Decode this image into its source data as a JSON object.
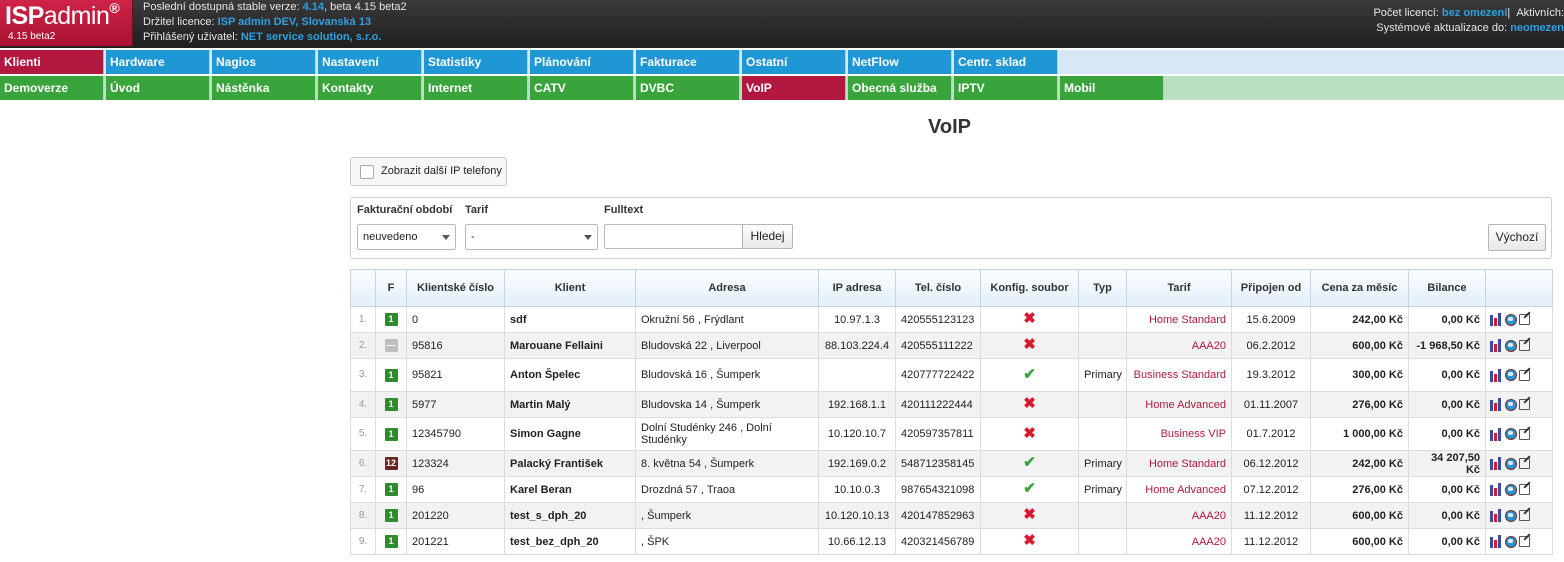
{
  "header": {
    "logo_main": "ISP",
    "logo_thin": "admin",
    "logo_reg": "®",
    "logo_version": "4.15 beta2",
    "line1_prefix": "Poslední dostupná stable verze:",
    "line1_stable": "4.14",
    "line1_suffix": ", beta 4.15 beta2",
    "line2_prefix": "Držitel licence:",
    "line2_value": "ISP admin DEV, Slovanská 13",
    "line3_prefix": "Přihlášený uživatel:",
    "line3_value": "NET service solution, s.r.o.",
    "right1_prefix": "Počet licencí:",
    "right1_value": "bez omezení",
    "right1_sep": "|",
    "right1_suffix": "Aktivních:",
    "right2_prefix": "Systémové aktualizace do:",
    "right2_value": "neomezen"
  },
  "menu_row1": [
    "Klienti",
    "Hardware",
    "Nagios",
    "Nastavení",
    "Statistiky",
    "Plánování",
    "Fakturace",
    "Ostatní",
    "NetFlow",
    "Centr. sklad"
  ],
  "menu_row2": [
    "Demoverze",
    "Úvod",
    "Nástěnka",
    "Kontakty",
    "Internet",
    "CATV",
    "DVBC",
    "VoIP",
    "Obecná služba",
    "IPTV",
    "Mobil"
  ],
  "colors": {
    "active_menu": "#b2183f",
    "menu_blue": "#1e97d4",
    "menu_green": "#3aa43c"
  },
  "page_title": "VoIP",
  "toggle_label": "Zobrazit další IP telefony",
  "filter": {
    "period_label": "Fakturační období",
    "period_value": "neuvedeno",
    "tariff_label": "Tarif",
    "tariff_value": "-",
    "fulltext_label": "Fulltext",
    "fulltext_value": "",
    "search_button": "Hledej",
    "default_button": "Výchozí"
  },
  "table": {
    "headers": [
      "",
      "F",
      "Klientské číslo",
      "Klient",
      "Adresa",
      "IP adresa",
      "Tel. číslo",
      "Konfig. soubor",
      "Typ",
      "Tarif",
      "Připojen od",
      "Cena za měsíc",
      "Bilance",
      ""
    ],
    "rows": [
      {
        "n": "1.",
        "f": "1",
        "f_style": "green",
        "cislo": "0",
        "klient": "sdf",
        "adresa": "Okružní 56 , Frýdlant",
        "ip": "10.97.1.3",
        "tel": "420555123123",
        "konfig": "no",
        "typ": "",
        "tarif": "Home Standard",
        "od": "15.6.2009",
        "cena": "242,00 Kč",
        "bilance": "0,00 Kč",
        "tall": false
      },
      {
        "n": "2.",
        "f": "—",
        "f_style": "gray",
        "cislo": "95816",
        "klient": "Marouane Fellaini",
        "adresa": "Bludovská 22 , Liverpool",
        "ip": "88.103.224.4",
        "tel": "420555111222",
        "konfig": "no",
        "typ": "",
        "tarif": "AAA20",
        "od": "06.2.2012",
        "cena": "600,00 Kč",
        "bilance": "-1 968,50 Kč",
        "tall": false
      },
      {
        "n": "3.",
        "f": "1",
        "f_style": "green",
        "cislo": "95821",
        "klient": "Anton Špelec",
        "adresa": "Bludovská 16 , Šumperk",
        "ip": "",
        "tel": "420777722422",
        "konfig": "yes",
        "typ": "Primary",
        "tarif": "Business Standard",
        "od": "19.3.2012",
        "cena": "300,00 Kč",
        "bilance": "0,00 Kč",
        "tall": true
      },
      {
        "n": "4.",
        "f": "1",
        "f_style": "green",
        "cislo": "5977",
        "klient": "Martin Malý",
        "adresa": "Bludovska 14 , Šumperk",
        "ip": "192.168.1.1",
        "tel": "420111222444",
        "konfig": "no",
        "typ": "",
        "tarif": "Home Advanced",
        "od": "01.11.2007",
        "cena": "276,00 Kč",
        "bilance": "0,00 Kč",
        "tall": false
      },
      {
        "n": "5.",
        "f": "1",
        "f_style": "green",
        "cislo": "12345790",
        "klient": "Simon Gagne",
        "adresa": "Dolní Studénky 246 , Dolní Studénky",
        "ip": "10.120.10.7",
        "tel": "420597357811",
        "konfig": "no",
        "typ": "",
        "tarif": "Business VIP",
        "od": "01.7.2012",
        "cena": "1 000,00 Kč",
        "bilance": "0,00 Kč",
        "tall": true
      },
      {
        "n": "6.",
        "f": "12",
        "f_style": "dark",
        "cislo": "123324",
        "klient": "Palacký František",
        "adresa": "8. května 54 , Šumperk",
        "ip": "192.169.0.2",
        "tel": "548712358145",
        "konfig": "yes",
        "typ": "Primary",
        "tarif": "Home Standard",
        "od": "06.12.2012",
        "cena": "242,00 Kč",
        "bilance": "34 207,50 Kč",
        "tall": false
      },
      {
        "n": "7.",
        "f": "1",
        "f_style": "green",
        "cislo": "96",
        "klient": "Karel Beran",
        "adresa": "Drozdná 57 , Traoa",
        "ip": "10.10.0.3",
        "tel": "987654321098",
        "konfig": "yes",
        "typ": "Primary",
        "tarif": "Home Advanced",
        "od": "07.12.2012",
        "cena": "276,00 Kč",
        "bilance": "0,00 Kč",
        "tall": false
      },
      {
        "n": "8.",
        "f": "1",
        "f_style": "green",
        "cislo": "201220",
        "klient": "test_s_dph_20",
        "adresa": ", Šumperk",
        "ip": "10.120.10.13",
        "tel": "420147852963",
        "konfig": "no",
        "typ": "",
        "tarif": "AAA20",
        "od": "11.12.2012",
        "cena": "600,00 Kč",
        "bilance": "0,00 Kč",
        "tall": false
      },
      {
        "n": "9.",
        "f": "1",
        "f_style": "green",
        "cislo": "201221",
        "klient": "test_bez_dph_20",
        "adresa": ", ŠPK",
        "ip": "10.66.12.13",
        "tel": "420321456789",
        "konfig": "no",
        "typ": "",
        "tarif": "AAA20",
        "od": "11.12.2012",
        "cena": "600,00 Kč",
        "bilance": "0,00 Kč",
        "tall": false
      }
    ],
    "row_action_icons": [
      "stats-icon",
      "globe-icon",
      "edit-icon"
    ]
  }
}
